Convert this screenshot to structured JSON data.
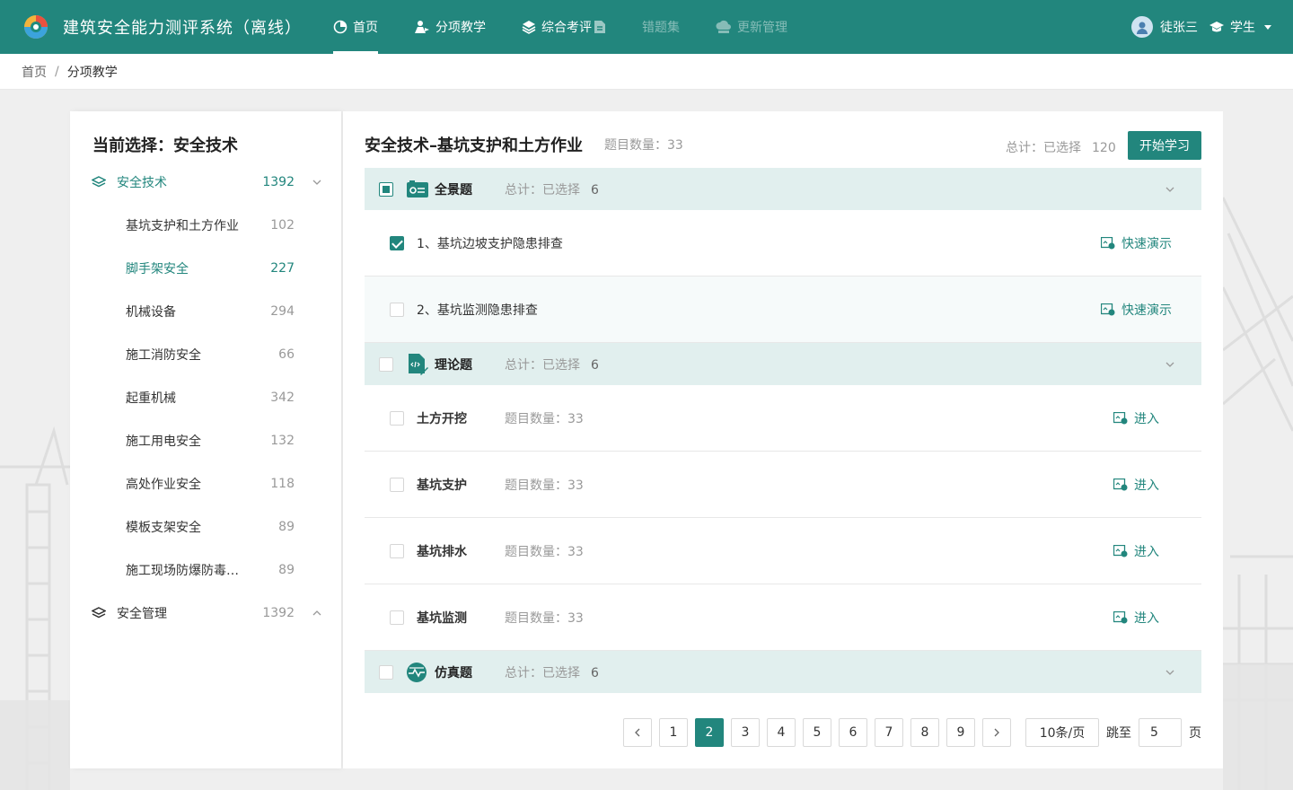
{
  "header": {
    "app_title": "建筑安全能力测评系统（离线）",
    "nav": [
      {
        "label": "首页",
        "icon": "home-pie-icon",
        "active": true,
        "disabled": false
      },
      {
        "label": "分项教学",
        "icon": "teaching-icon",
        "active": false,
        "disabled": false
      },
      {
        "label": "综合考评",
        "icon": "layers-icon",
        "active": false,
        "disabled": false
      },
      {
        "label": "错题集",
        "icon": "document-icon",
        "active": false,
        "disabled": true
      },
      {
        "label": "更新管理",
        "icon": "cloud-sync-icon",
        "active": false,
        "disabled": true
      }
    ],
    "user_name": "徒张三",
    "role": "学生"
  },
  "breadcrumb": {
    "home": "首页",
    "separator": "/",
    "current": "分项教学"
  },
  "left": {
    "title": "当前选择：安全技术",
    "categories": [
      {
        "label": "安全技术",
        "count": "1392",
        "expanded": true,
        "active": true
      },
      {
        "label": "安全管理",
        "count": "1392",
        "expanded": false,
        "active": false
      }
    ],
    "subitems": [
      {
        "label": "基坑支护和土方作业",
        "count": "102"
      },
      {
        "label": "脚手架安全",
        "count": "227",
        "active": true
      },
      {
        "label": "机械设备",
        "count": "294"
      },
      {
        "label": "施工消防安全",
        "count": "66"
      },
      {
        "label": "起重机械",
        "count": "342"
      },
      {
        "label": "施工用电安全",
        "count": "132"
      },
      {
        "label": "高处作业安全",
        "count": "118"
      },
      {
        "label": "模板支架安全",
        "count": "89"
      },
      {
        "label": "施工现场防爆防毒安全",
        "count": "89"
      }
    ]
  },
  "main": {
    "title": "安全技术–基坑支护和土方作业",
    "question_count": "题目数量：33",
    "total_label": "总计：已选择",
    "total_value": "120",
    "start_button": "开始学习",
    "groups": [
      {
        "label": "全景题",
        "total_label": "总计：已选择",
        "total_value": "6",
        "state": "indeterminate",
        "icon": "panorama-icon"
      },
      {
        "label": "理论题",
        "total_label": "总计：已选择",
        "total_value": "6",
        "state": "unchecked",
        "icon": "code-doc-icon"
      },
      {
        "label": "仿真题",
        "total_label": "总计：已选择",
        "total_value": "6",
        "state": "unchecked",
        "icon": "simulation-icon"
      }
    ],
    "panorama_items": [
      {
        "label": "1、基坑边坡支护隐患排查",
        "action": "快速演示",
        "checked": true
      },
      {
        "label": "2、基坑监测隐患排查",
        "action": "快速演示",
        "checked": false
      }
    ],
    "theory_items": [
      {
        "label": "土方开挖",
        "qcount": "题目数量：33",
        "action": "进入"
      },
      {
        "label": "基坑支护",
        "qcount": "题目数量：33",
        "action": "进入"
      },
      {
        "label": "基坑排水",
        "qcount": "题目数量：33",
        "action": "进入"
      },
      {
        "label": "基坑监测",
        "qcount": "题目数量：33",
        "action": "进入"
      }
    ]
  },
  "pagination": {
    "pages": [
      "1",
      "2",
      "3",
      "4",
      "5",
      "6",
      "7",
      "8",
      "9"
    ],
    "current": "2",
    "page_size": "10条/页",
    "jump_label": "跳至",
    "jump_value": "5",
    "page_suffix": "页"
  },
  "colors": {
    "brand": "#22867d",
    "group_bg": "#e1efee"
  }
}
